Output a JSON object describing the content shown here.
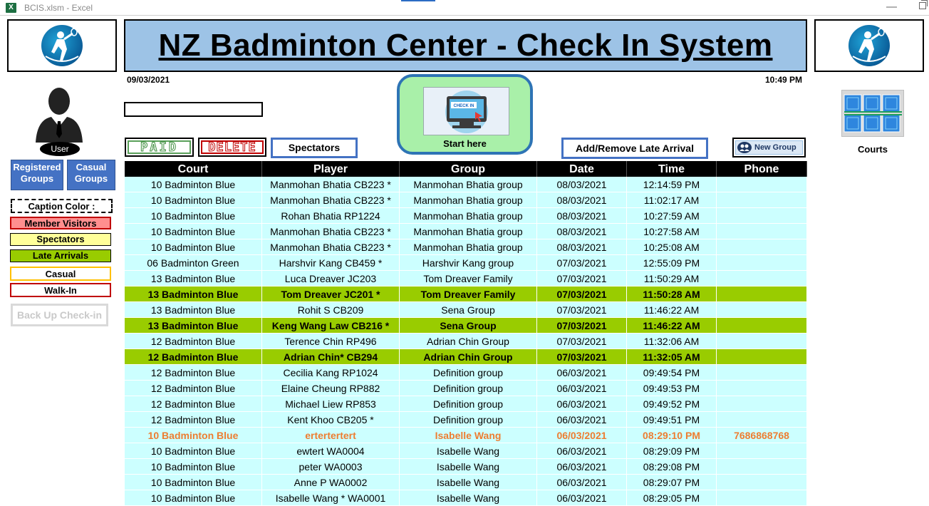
{
  "window": {
    "title": "BCIS.xlsm  -  Excel",
    "app_icon": "X",
    "minimize": "—"
  },
  "header": {
    "title": "NZ Badminton Center - Check In System "
  },
  "date": "09/03/2021",
  "time": "10:49 PM",
  "sidebar": {
    "user_label": "User",
    "registered_groups": "Registered Groups",
    "casual_groups": "Casual Groups",
    "caption_title": "Caption Color :",
    "captions": [
      {
        "label": "Member Visitors",
        "bg": "#ff8f8f",
        "border": "#c00000"
      },
      {
        "label": "Spectators",
        "bg": "#ffff99",
        "border": "#000000"
      },
      {
        "label": "Late Arrivals",
        "bg": "#99cc00",
        "border": "#000000"
      },
      {
        "label": "Casual",
        "bg": "#ffffff",
        "border": "#ffc000"
      },
      {
        "label": "Walk-In",
        "bg": "#ffffff",
        "border": "#c00000"
      }
    ],
    "backup": "Back Up Check-in"
  },
  "toolbar": {
    "paid": "PAID",
    "delete": "DELETE",
    "spectators": "Spectators",
    "start_here": "Start here",
    "checkin_screen_text": "CHECK IN",
    "late_arrival": "Add/Remove Late Arrival",
    "new_group": "New Group"
  },
  "courts_label": "Courts",
  "colors": {
    "header_bg": "#9dc3e6",
    "row_normal": "#ccffff",
    "row_late": "#99cc00",
    "casual_text": "#ed7d31",
    "accent_blue": "#4472c4"
  },
  "table": {
    "headers": [
      "Court",
      "Player",
      "Group",
      "Date",
      "Time",
      "Phone"
    ],
    "rows": [
      {
        "type": "normal",
        "cells": [
          "10  Badminton Blue",
          "Manmohan Bhatia CB223 *",
          "Manmohan Bhatia group",
          "08/03/2021",
          "12:14:59 PM",
          ""
        ]
      },
      {
        "type": "normal",
        "cells": [
          "10  Badminton Blue",
          "Manmohan Bhatia CB223 *",
          "Manmohan Bhatia group",
          "08/03/2021",
          "11:02:17 AM",
          ""
        ]
      },
      {
        "type": "normal",
        "cells": [
          "10  Badminton Blue",
          "Rohan Bhatia RP1224",
          "Manmohan Bhatia group",
          "08/03/2021",
          "10:27:59 AM",
          ""
        ]
      },
      {
        "type": "normal",
        "cells": [
          "10  Badminton Blue",
          "Manmohan Bhatia CB223 *",
          "Manmohan Bhatia group",
          "08/03/2021",
          "10:27:58 AM",
          ""
        ]
      },
      {
        "type": "normal",
        "cells": [
          "10  Badminton Blue",
          "Manmohan Bhatia CB223 *",
          "Manmohan Bhatia group",
          "08/03/2021",
          "10:25:08 AM",
          ""
        ]
      },
      {
        "type": "normal",
        "cells": [
          "06  Badminton Green",
          "Harshvir Kang CB459 *",
          "Harshvir Kang group",
          "07/03/2021",
          "12:55:09 PM",
          ""
        ]
      },
      {
        "type": "normal",
        "cells": [
          "13  Badminton Blue",
          "Luca Dreaver JC203",
          "Tom Dreaver Family",
          "07/03/2021",
          "11:50:29 AM",
          ""
        ]
      },
      {
        "type": "late",
        "cells": [
          "13  Badminton Blue",
          "Tom Dreaver JC201 *",
          "Tom Dreaver Family",
          "07/03/2021",
          "11:50:28 AM",
          ""
        ]
      },
      {
        "type": "normal",
        "cells": [
          "13  Badminton Blue",
          "Rohit S CB209",
          "Sena Group",
          "07/03/2021",
          "11:46:22 AM",
          ""
        ]
      },
      {
        "type": "late",
        "cells": [
          "13  Badminton Blue",
          "Keng Wang Law CB216 *",
          "Sena Group",
          "07/03/2021",
          "11:46:22 AM",
          ""
        ]
      },
      {
        "type": "normal",
        "cells": [
          "12  Badminton Blue",
          "Terence Chin RP496",
          "Adrian Chin Group",
          "07/03/2021",
          "11:32:06 AM",
          ""
        ]
      },
      {
        "type": "late",
        "cells": [
          "12  Badminton Blue",
          "Adrian Chin* CB294",
          "Adrian Chin Group",
          "07/03/2021",
          "11:32:05 AM",
          ""
        ]
      },
      {
        "type": "normal",
        "cells": [
          "12  Badminton Blue",
          "Cecilia Kang RP1024",
          "Definition group",
          "06/03/2021",
          "09:49:54 PM",
          ""
        ]
      },
      {
        "type": "normal",
        "cells": [
          "12  Badminton Blue",
          "Elaine Cheung RP882",
          "Definition group",
          "06/03/2021",
          "09:49:53 PM",
          ""
        ]
      },
      {
        "type": "normal",
        "cells": [
          "12  Badminton Blue",
          "Michael Liew RP853",
          "Definition group",
          "06/03/2021",
          "09:49:52 PM",
          ""
        ]
      },
      {
        "type": "normal",
        "cells": [
          "12  Badminton Blue",
          "Kent Khoo CB205 *",
          "Definition group",
          "06/03/2021",
          "09:49:51 PM",
          ""
        ]
      },
      {
        "type": "casual",
        "cells": [
          "10  Badminton Blue",
          "ertertertert",
          "Isabelle Wang",
          "06/03/2021",
          "08:29:10 PM",
          "7686868768"
        ]
      },
      {
        "type": "normal",
        "cells": [
          "10  Badminton Blue",
          "ewtert WA0004",
          "Isabelle Wang",
          "06/03/2021",
          "08:29:09 PM",
          ""
        ]
      },
      {
        "type": "normal",
        "cells": [
          "10  Badminton Blue",
          "peter WA0003",
          "Isabelle Wang",
          "06/03/2021",
          "08:29:08 PM",
          ""
        ]
      },
      {
        "type": "normal",
        "cells": [
          "10  Badminton Blue",
          "Anne P WA0002",
          "Isabelle Wang",
          "06/03/2021",
          "08:29:07 PM",
          ""
        ]
      },
      {
        "type": "normal",
        "cells": [
          "10  Badminton Blue",
          "Isabelle Wang * WA0001",
          "Isabelle Wang",
          "06/03/2021",
          "08:29:05 PM",
          ""
        ]
      }
    ]
  }
}
